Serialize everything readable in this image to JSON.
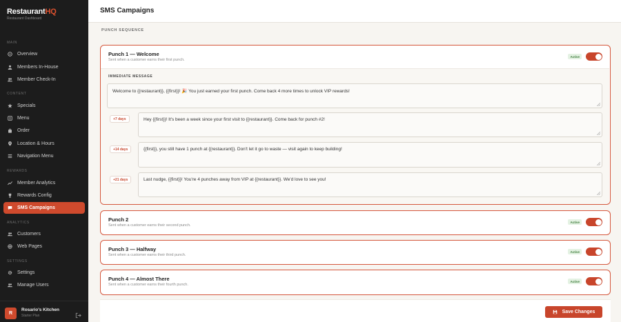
{
  "brand": {
    "name_main": "Restaurant",
    "name_accent": "HQ",
    "subtitle": "Restaurant Dashboard"
  },
  "sidebar": {
    "sections": [
      {
        "label": "MAIN",
        "items": [
          {
            "label": "Overview",
            "icon": "dashboard-icon"
          },
          {
            "label": "Members In-House",
            "icon": "user-icon"
          },
          {
            "label": "Member Check-In",
            "icon": "users-icon"
          }
        ]
      },
      {
        "label": "CONTENT",
        "items": [
          {
            "label": "Specials",
            "icon": "star-icon"
          },
          {
            "label": "Menu",
            "icon": "menu-icon"
          },
          {
            "label": "Order",
            "icon": "bag-icon"
          },
          {
            "label": "Location & Hours",
            "icon": "pin-icon"
          },
          {
            "label": "Navigation Menu",
            "icon": "nav-icon"
          }
        ]
      },
      {
        "label": "REWARDS",
        "items": [
          {
            "label": "Member Analytics",
            "icon": "chart-icon"
          },
          {
            "label": "Rewards Config",
            "icon": "trophy-icon"
          },
          {
            "label": "SMS Campaigns",
            "icon": "message-icon",
            "active": true
          }
        ]
      },
      {
        "label": "ANALYTICS",
        "items": [
          {
            "label": "Customers",
            "icon": "users-icon"
          },
          {
            "label": "Web Pages",
            "icon": "globe-icon"
          }
        ]
      },
      {
        "label": "SETTINGS",
        "items": [
          {
            "label": "Settings",
            "icon": "gear-icon"
          },
          {
            "label": "Manage Users",
            "icon": "users-icon"
          }
        ]
      }
    ]
  },
  "user": {
    "initial": "R",
    "name": "Rosario's Kitchen",
    "plan": "Starter Plan"
  },
  "header": {
    "title": "SMS Campaigns"
  },
  "main": {
    "sequence_label": "PUNCH SEQUENCE",
    "punches": [
      {
        "title": "Punch 1 — Welcome",
        "subtitle": "Sent when a customer earns their first punch.",
        "status": "Active",
        "expanded": true,
        "immediate_label": "IMMEDIATE MESSAGE",
        "immediate_message": "Welcome to {{restaurant}}, {{first}}! 🎉 You just earned your first punch. Come back 4 more times to unlock VIP rewards!",
        "followups": [
          {
            "delay": "+7 days",
            "message": "Hey {{first}}! It's been a week since your first visit to {{restaurant}}. Come back for punch #2!"
          },
          {
            "delay": "+14 days",
            "message": "{{first}}, you still have 1 punch at {{restaurant}}. Don't let it go to waste — visit again to keep building!"
          },
          {
            "delay": "+21 days",
            "message": "Last nudge, {{first}}! You're 4 punches away from VIP at {{restaurant}}. We'd love to see you!"
          }
        ]
      },
      {
        "title": "Punch 2",
        "subtitle": "Sent when a customer earns their second punch.",
        "status": "Active"
      },
      {
        "title": "Punch 3 — Halfway",
        "subtitle": "Sent when a customer earns their third punch.",
        "status": "Active"
      },
      {
        "title": "Punch 4 — Almost There",
        "subtitle": "Sent when a customer earns their fourth punch.",
        "status": "Active"
      }
    ],
    "save_label": "Save Changes"
  },
  "colors": {
    "accent": "#c8452b",
    "sidebar_bg": "#1c1c1c",
    "active_badge_bg": "#e4f2e3",
    "active_badge_text": "#3f7d3c"
  }
}
